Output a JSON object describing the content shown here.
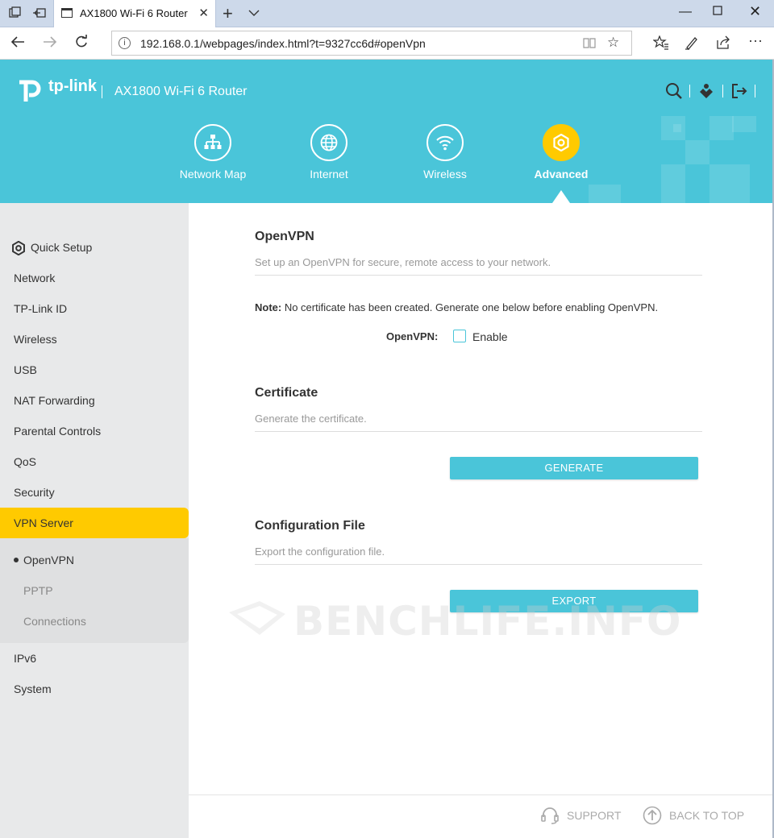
{
  "browser": {
    "tab_title": "AX1800 Wi-Fi 6 Router",
    "url": "192.168.0.1/webpages/index.html?t=9327cc6d#openVpn",
    "icons": [
      "tab-actions-icon",
      "set-aside-tabs-icon",
      "page-icon",
      "close-icon",
      "new-tab-icon",
      "tab-list-icon",
      "minimize-icon",
      "maximize-icon",
      "close-window-icon",
      "back-icon",
      "forward-icon",
      "refresh-icon",
      "info-icon",
      "reading-view-icon",
      "favorite-star-icon",
      "favorites-icon",
      "pen-icon",
      "share-icon",
      "more-icon"
    ]
  },
  "router": {
    "brand": "tp-link",
    "separator": "|",
    "product": "AX1800 Wi-Fi 6 Router",
    "nav": [
      {
        "label": "Network Map",
        "icon": "network-map-icon"
      },
      {
        "label": "Internet",
        "icon": "globe-icon"
      },
      {
        "label": "Wireless",
        "icon": "wifi-icon"
      },
      {
        "label": "Advanced",
        "icon": "advanced-gear-icon",
        "active": true
      }
    ],
    "header_icons": [
      "search-icon",
      "tether-icon",
      "logout-icon"
    ]
  },
  "sidebar": {
    "items": [
      "Quick Setup",
      "Network",
      "TP-Link ID",
      "Wireless",
      "USB",
      "NAT Forwarding",
      "Parental Controls",
      "QoS",
      "Security",
      "VPN Server",
      "IPv6",
      "System"
    ],
    "active": "VPN Server",
    "sub_items": [
      "OpenVPN",
      "PPTP",
      "Connections"
    ],
    "current_sub": "OpenVPN"
  },
  "content": {
    "openvpn": {
      "title": "OpenVPN",
      "desc": "Set up an OpenVPN for secure, remote access to your network.",
      "note_label": "Note:",
      "note_text": " No certificate has been created. Generate one below before enabling OpenVPN.",
      "field_label": "OpenVPN:",
      "enable_label": "Enable",
      "enabled": false
    },
    "certificate": {
      "title": "Certificate",
      "desc": "Generate the certificate.",
      "button": "GENERATE"
    },
    "config": {
      "title": "Configuration File",
      "desc": "Export the configuration file.",
      "button": "EXPORT"
    }
  },
  "watermark": "BENCHLIFE.INFO",
  "footer": {
    "support": "SUPPORT",
    "back_to_top": "BACK TO TOP"
  },
  "colors": {
    "accent": "#4ac5d9",
    "active": "#ffca00",
    "sidebar_bg": "#e8e9ea"
  }
}
